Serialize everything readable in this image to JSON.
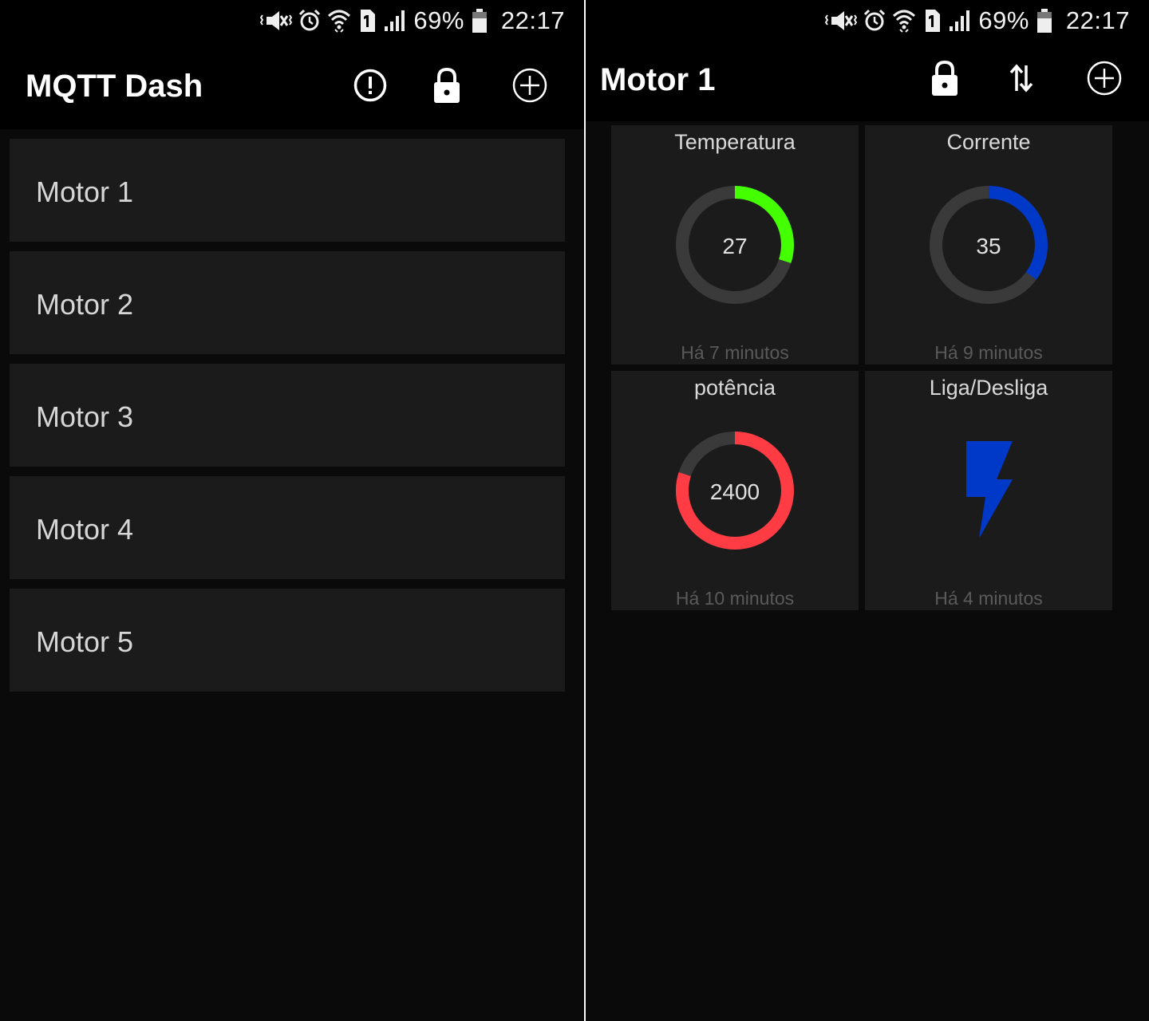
{
  "status": {
    "battery": "69%",
    "time": "22:17"
  },
  "left": {
    "title": "MQTT Dash",
    "icons": [
      "alert-icon",
      "lock-icon",
      "add-icon"
    ],
    "items": [
      {
        "label": "Motor 1"
      },
      {
        "label": "Motor 2"
      },
      {
        "label": "Motor 3"
      },
      {
        "label": "Motor 4"
      },
      {
        "label": "Motor 5"
      }
    ]
  },
  "right": {
    "title": "Motor 1",
    "icons": [
      "lock-icon",
      "sort-arrows-icon",
      "add-icon"
    ],
    "tiles": [
      {
        "title": "Temperatura",
        "value": "27",
        "fraction": 0.3,
        "color": "#44ff00",
        "updated": "Há 7 minutos"
      },
      {
        "title": "Corrente",
        "value": "35",
        "fraction": 0.35,
        "color": "#0038c8",
        "updated": "Há 9 minutos"
      },
      {
        "title": "potência",
        "value": "2400",
        "fraction": 0.8,
        "color": "#ff3b44",
        "updated": "Há 10 minutos"
      },
      {
        "title": "Liga/Desliga",
        "icon": "lightning-bolt-icon",
        "color": "#0038c8",
        "updated": "Há 4 minutos"
      }
    ]
  }
}
